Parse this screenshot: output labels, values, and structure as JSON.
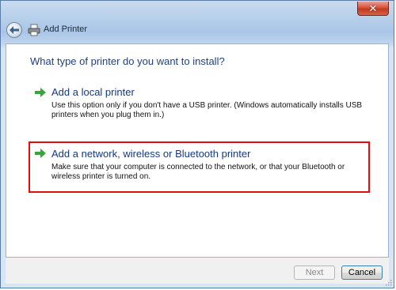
{
  "window": {
    "title": "Add Printer",
    "close_label": "✕"
  },
  "main": {
    "heading": "What type of printer do you want to install?",
    "options": [
      {
        "title": "Add a local printer",
        "description": "Use this option only if you don't have a USB printer. (Windows automatically installs USB printers when you plug them in.)"
      },
      {
        "title": "Add a network, wireless or Bluetooth printer",
        "description": "Make sure that your computer is connected to the network, or that your Bluetooth or wireless printer is turned on."
      }
    ]
  },
  "footer": {
    "next_label": "Next",
    "cancel_label": "Cancel"
  },
  "colors": {
    "heading": "#1f3f8a",
    "highlight_border": "#e20d0d",
    "close_button": "#c23a20"
  },
  "icons": [
    "back-arrow-icon",
    "printer-icon",
    "green-arrow-icon",
    "close-icon"
  ]
}
